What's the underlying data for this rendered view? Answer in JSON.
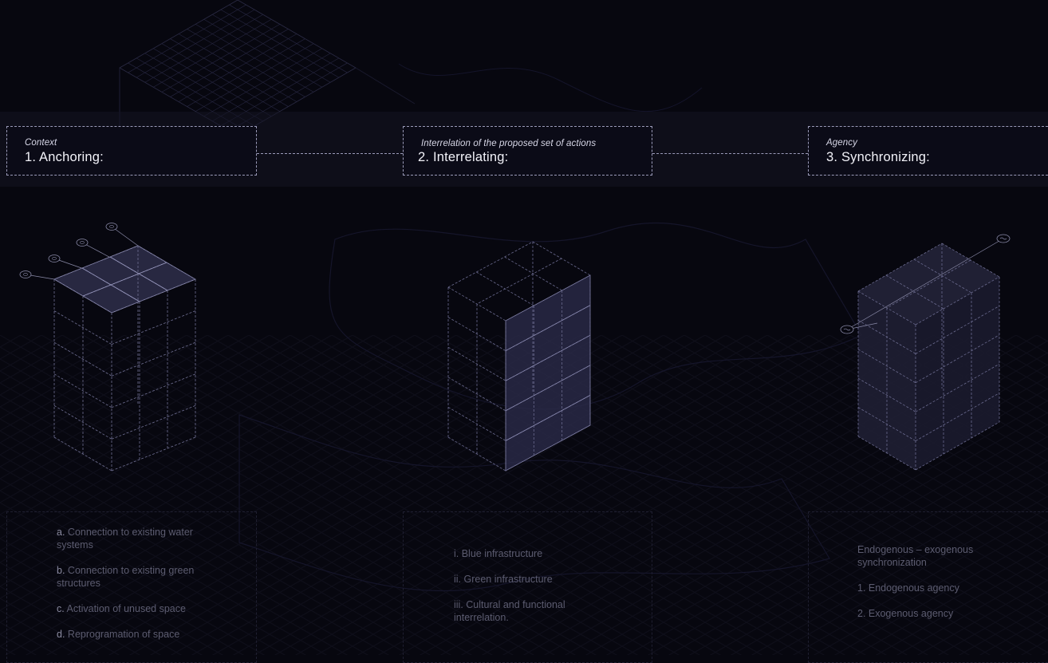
{
  "stages": [
    {
      "subtitle": "Context",
      "title": "1. Anchoring:",
      "items": [
        {
          "label": "a.",
          "text": "Connection to existing water systems"
        },
        {
          "label": "b.",
          "text": "Connection to existing green structures"
        },
        {
          "label": "c.",
          "text": "Activation of unused space"
        },
        {
          "label": "d.",
          "text": "Reprogramation of space"
        }
      ]
    },
    {
      "subtitle": "Interrelation of the proposed set of actions",
      "title": "2. Interrelating:",
      "items": [
        {
          "text": "i. Blue infrastructure"
        },
        {
          "text": "ii. Green infrastructure"
        },
        {
          "text": "iii. Cultural and functional interrelation."
        }
      ]
    },
    {
      "subtitle": "Agency",
      "title": "3. Synchronizing:",
      "items": [
        {
          "text": "Endogenous – exogenous synchronization"
        },
        {
          "text": "1. Endogenous agency"
        },
        {
          "text": "2. Exogenous agency"
        }
      ]
    }
  ],
  "colors": {
    "background": "#07070f",
    "dashed_line": "#9a9ab8",
    "grid": "#2a2a48",
    "highlight_face": "#3a3a5a"
  }
}
